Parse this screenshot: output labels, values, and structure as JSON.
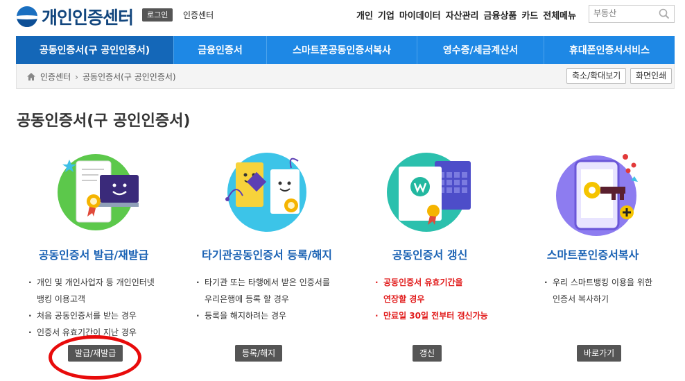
{
  "header": {
    "logo": "개인인증센터",
    "login": "로그인",
    "cert_center": "인증센터",
    "nav": [
      "개인",
      "기업",
      "마이데이터",
      "자산관리",
      "금융상품",
      "카드",
      "전체메뉴"
    ],
    "search_placeholder": "부동산"
  },
  "menu": [
    {
      "label": "공동인증서(구 공인인증서)",
      "active": true
    },
    {
      "label": "금융인증서",
      "active": false
    },
    {
      "label": "스마트폰공동인증서복사",
      "active": false
    },
    {
      "label": "영수증/세금계산서",
      "active": false
    },
    {
      "label": "휴대폰인증서서비스",
      "active": false
    }
  ],
  "breadcrumb": {
    "home": "인증센터",
    "current": "공동인증서(구 공인인증서)",
    "zoom": "축소/확대보기",
    "print": "화면인쇄"
  },
  "page_title": "공동인증서(구 공인인증서)",
  "cards": [
    {
      "title": "공동인증서 발급/재발급",
      "lines": [
        {
          "text": "개인 및 개인사업자 등 개인인터넷",
          "cont": "뱅킹 이용고객"
        },
        {
          "text": "처음 공동인증서를 받는 경우"
        },
        {
          "text": "인증서 유효기간이 지난 경우"
        }
      ],
      "button": "발급/재발급"
    },
    {
      "title": "타기관공동인증서 등록/해지",
      "lines": [
        {
          "text": "타기관 또는 타행에서 받은 인증서를",
          "cont": "우리은행에 등록 할 경우"
        },
        {
          "text": "등록을 해지하려는 경우"
        }
      ],
      "button": "등록/해지"
    },
    {
      "title": "공동인증서 갱신",
      "lines": [
        {
          "text": "공동인증서 유효기간을",
          "cont": "연장할 경우",
          "red": true
        },
        {
          "text": "만료일 30일 전부터 갱신가능",
          "red": true
        }
      ],
      "button": "갱신"
    },
    {
      "title": "스마트폰인증서복사",
      "lines": [
        {
          "text": "우리 스마트뱅킹 이용을 위한",
          "cont": "인증서 복사하기"
        }
      ],
      "button": "바로가기"
    }
  ],
  "colors": {
    "menu_bg": "#1e88e5",
    "menu_active": "#1467b8",
    "card_title": "#1a62b4",
    "highlight_red": "#e11b1b"
  }
}
